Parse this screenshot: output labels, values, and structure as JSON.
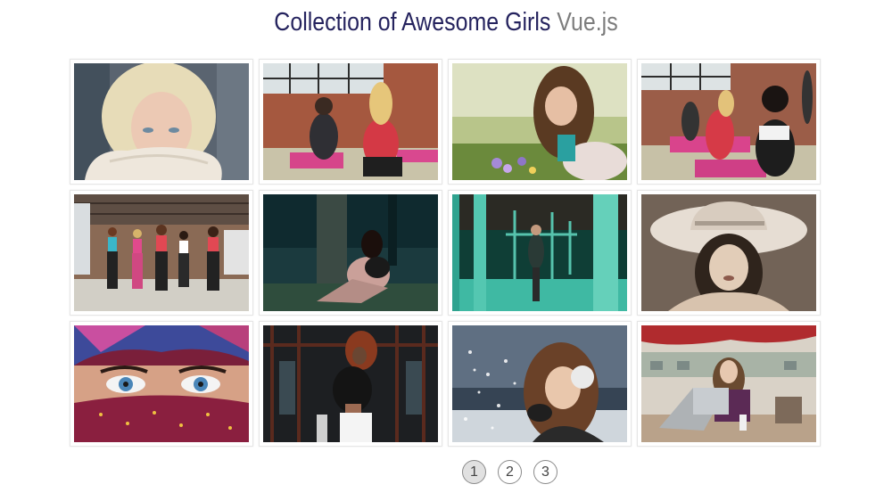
{
  "header": {
    "title_main": "Collection of Awesome Girls",
    "title_accent": "Vue.js"
  },
  "gallery": {
    "photos": [
      {
        "subject": "blonde woman with white knit sweater over face"
      },
      {
        "subject": "two women doing yoga in brick studio"
      },
      {
        "subject": "woman lying in grass with flowers"
      },
      {
        "subject": "women stretching on yoga mats in gym"
      },
      {
        "subject": "five women dancing in loft studio"
      },
      {
        "subject": "woman sitting by tree in dark forest"
      },
      {
        "subject": "woman standing among teal poles"
      },
      {
        "subject": "woman in wide brim hat sepia portrait"
      },
      {
        "subject": "woman with blue eyes wearing patterned scarf veil"
      },
      {
        "subject": "woman with curly red hair in dark industrial setting"
      },
      {
        "subject": "woman with earmuffs blowing snow"
      },
      {
        "subject": "woman with laptop at cafe"
      }
    ]
  },
  "pagination": {
    "pages": [
      "1",
      "2",
      "3"
    ],
    "active": "1"
  }
}
